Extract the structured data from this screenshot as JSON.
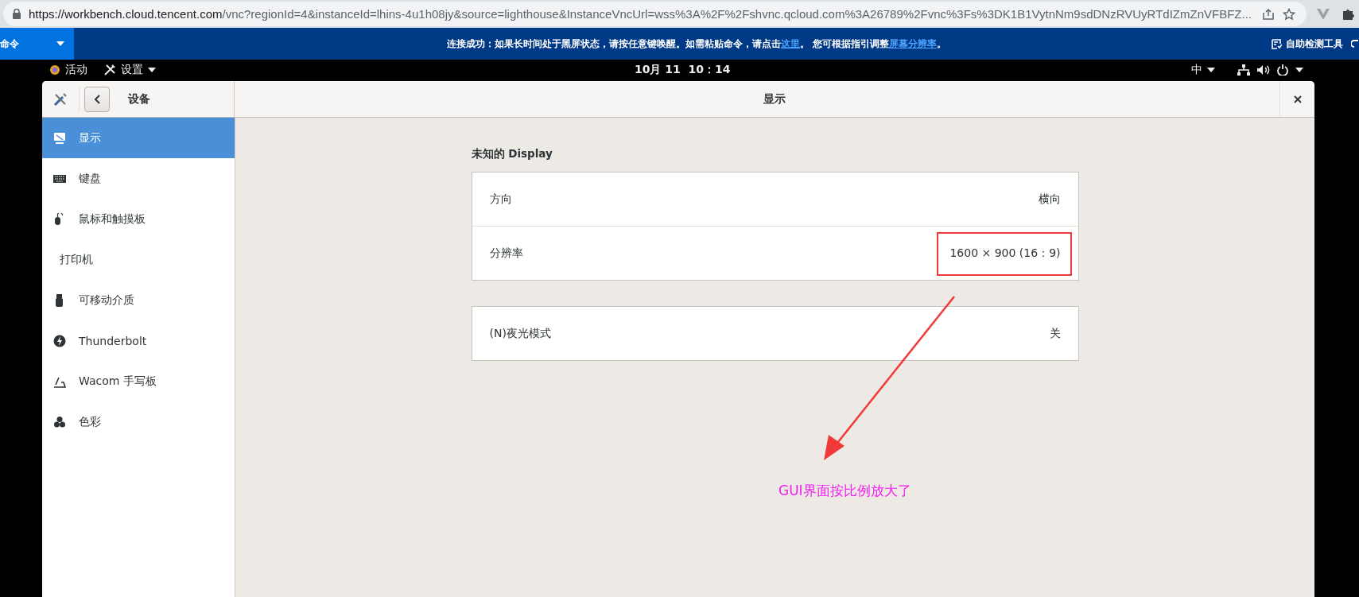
{
  "browser": {
    "url_host": "https://workbench.cloud.tencent.com",
    "url_path": "/vnc?regionId=4&instanceId=lhins-4u1h08jy&source=lighthouse&InstanceVncUrl=wss%3A%2F%2Fshvnc.qcloud.com%3A26789%2Fvnc%3Fs%3DK1B1VytnNm9sdDNzRVUyRTdIZmZnVFBFZ..."
  },
  "notice_bar": {
    "command_menu": "命令",
    "message": [
      {
        "kind": "text",
        "text": "连接成功：如果长时间处于黑屏状态，请按任意键唤醒。如需粘贴命令，请点击"
      },
      {
        "kind": "link",
        "text": "这里"
      },
      {
        "kind": "text",
        "text": "。 您可根据指引调整"
      },
      {
        "kind": "link",
        "text": "屏幕分辨率"
      },
      {
        "kind": "text",
        "text": "。"
      }
    ],
    "tool": "自助检测工具"
  },
  "top_bar": {
    "activities": "活动",
    "app_menu": "设置",
    "clock": "10月 11  10：14",
    "input_method": "中"
  },
  "window": {
    "sidebar_title": "设备",
    "title": "显示",
    "sidebar": {
      "items": [
        {
          "label": "显示",
          "kind": "display",
          "selected": true
        },
        {
          "label": "键盘",
          "kind": "keyboard",
          "selected": false
        },
        {
          "label": "鼠标和触摸板",
          "kind": "mouse",
          "selected": false
        },
        {
          "label": "打印机",
          "kind": "plain",
          "selected": false
        },
        {
          "label": "可移动介质",
          "kind": "usb",
          "selected": false
        },
        {
          "label": "Thunderbolt",
          "kind": "thunderbolt",
          "selected": false
        },
        {
          "label": "Wacom 手写板",
          "kind": "tablet",
          "selected": false
        },
        {
          "label": "色彩",
          "kind": "color",
          "selected": false
        }
      ]
    },
    "section_title": "未知的 Display",
    "groups": [
      {
        "rows": [
          {
            "label": "方向",
            "value": "横向"
          },
          {
            "label": "分辨率",
            "value": "1600 × 900 (16：9)"
          }
        ]
      },
      {
        "rows": [
          {
            "label": "(N)夜光模式",
            "value": "关"
          }
        ]
      }
    ]
  },
  "annotation": {
    "text": "GUI界面按比例放大了"
  }
}
